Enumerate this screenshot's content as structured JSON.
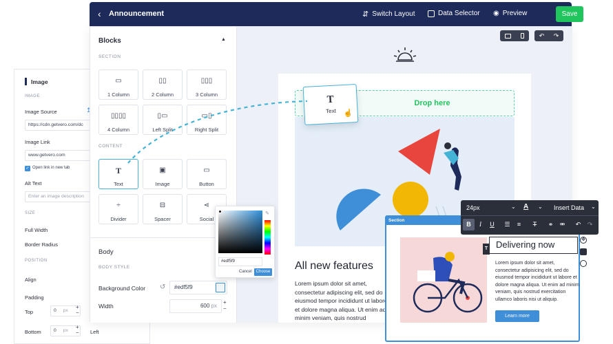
{
  "topbar": {
    "title": "Announcement",
    "switch_layout": "Switch Layout",
    "data_selector": "Data Selector",
    "preview": "Preview",
    "save": "Save"
  },
  "blocks_panel": {
    "title": "Blocks",
    "section_caption": "SECTION",
    "section_tiles": [
      "1 Column",
      "2 Column",
      "3 Column",
      "4 Column",
      "Left Split",
      "Right Split"
    ],
    "content_caption": "CONTENT",
    "content_tiles": [
      "Text",
      "Image",
      "Button",
      "Divider",
      "Spacer",
      "Social"
    ],
    "body_title": "Body",
    "body_style_caption": "BODY STYLE",
    "bg_color_label": "Background Color",
    "bg_color_value": "#edf5f9",
    "width_label": "Width",
    "width_value": "600",
    "width_unit": "px"
  },
  "canvas": {
    "drop_here": "Drop here",
    "drag_tile_label": "Text",
    "headline": "All new features",
    "body_text": "Lorem ipsum dolor sit amet, consectetur adipiscing elit, sed do eiusmod tempor incididunt ut labore et dolore magna aliqua. Ut enim ad minim veniam, quis nostrud exercitation ullamco laboris nisi ut aliquip ex ea commodo consequat."
  },
  "image_panel": {
    "title": "Image",
    "image_caption": "IMAGE",
    "image_source_label": "Image Source",
    "image_source_value": "https://cdn.getvero.com/dc",
    "image_link_label": "Image Link",
    "image_link_value": "www.getvero.com",
    "open_new_tab": "Open link in new tab",
    "alt_text_label": "Alt Text",
    "alt_text_placeholder": "Enter an image description",
    "size_caption": "SIZE",
    "full_width_label": "Full Width",
    "border_radius_label": "Border Radius",
    "position_caption": "POSITION",
    "align_label": "Align",
    "padding_label": "Padding",
    "top_label": "Top",
    "bottom_label": "Bottom",
    "left_label": "Left",
    "top_value": "0",
    "bottom_value": "0",
    "unit": "px"
  },
  "color_picker": {
    "hex_value": "#edf5f9",
    "cancel": "Cancel",
    "choose": "Choose"
  },
  "section_panel": {
    "label": "Section",
    "heading": "Delivering now",
    "body": "Lorem ipsum dolor sit amet, consectetur adipisicing elit, sed do eiusmod tempor incididunt ut labore et dolore magna aliqua. Ut enim ad minim veniam, quis nostrud exercitation ullamco laboris nisi ut aliquip.",
    "button": "Learn more"
  },
  "format_toolbar": {
    "font_size": "24px",
    "insert_data": "Insert Data"
  },
  "colors": {
    "navy": "#1e2a5a",
    "green": "#21c55d",
    "accent_blue": "#3e8ed8",
    "teal": "#45b3d6"
  }
}
